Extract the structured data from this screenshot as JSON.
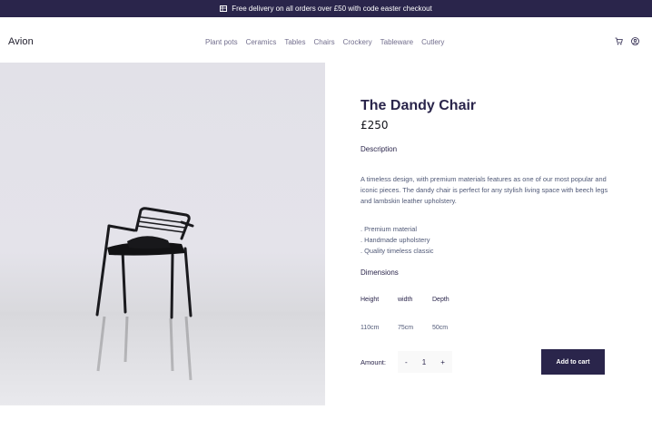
{
  "promo": {
    "icon": "delivery-truck-icon",
    "text": "Free delivery on all orders over £50 with code easter checkout"
  },
  "nav": {
    "logo": "Avion",
    "links": [
      "Plant pots",
      "Ceramics",
      "Tables",
      "Chairs",
      "Crockery",
      "Tableware",
      "Cutlery"
    ],
    "icons": [
      "cart-icon",
      "user-icon"
    ]
  },
  "product": {
    "title": "The Dandy Chair",
    "price": "£250",
    "description_label": "Description",
    "description": "A timeless design, with premium materials features as one of our most popular and iconic pieces. The dandy chair is perfect for any stylish living space with beech legs and lambskin leather upholstery.",
    "features": [
      ". Premium material",
      ". Handmade upholstery",
      ". Quality timeless classic"
    ],
    "dimensions_label": "Dimensions",
    "dimensions": {
      "headers": [
        "Height",
        "width",
        "Depth"
      ],
      "values": [
        "110cm",
        "75cm",
        "50cm"
      ]
    },
    "amount_label": "Amount:",
    "quantity": "1",
    "decrement": "-",
    "increment": "+",
    "add_to_cart": "Add to cart"
  },
  "colors": {
    "brand_dark": "#2a254b",
    "muted_text": "#505977",
    "nav_text": "#726e8d"
  }
}
